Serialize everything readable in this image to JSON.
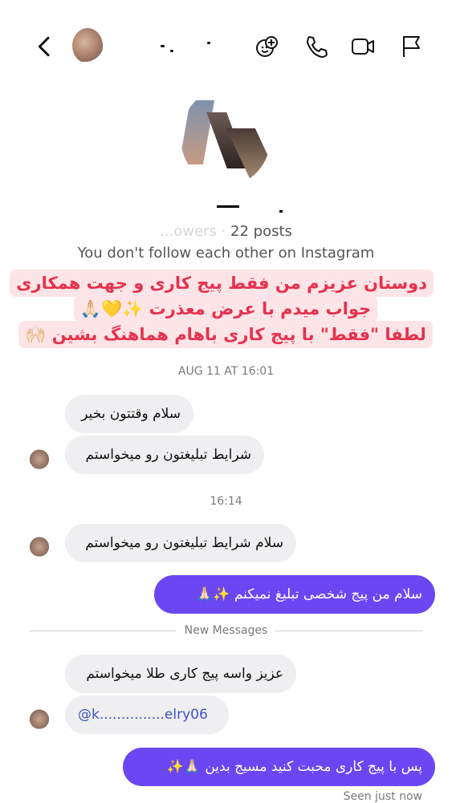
{
  "header": {
    "back_icon": "chevron-left-icon",
    "actions": [
      {
        "name": "effects-icon"
      },
      {
        "name": "phone-icon"
      },
      {
        "name": "video-icon"
      },
      {
        "name": "flag-icon"
      }
    ]
  },
  "profile": {
    "stats": "22 posts",
    "stats_prefix": "...owers · ",
    "follow_note": "You don't follow each other on Instagram"
  },
  "announcement": {
    "lines": [
      "دوستان عزیزم من فقط پیج کاری و جهت همکاری",
      "جواب میدم با عرض معذرت ✨💛🙏🏻",
      "لطفا \"فقط\" با پیج کاری باهام هماهنگ بشین 🙌🏻"
    ]
  },
  "conversation": {
    "timestamp_1": "AUG 11 AT 16:01",
    "timestamp_2": "16:14",
    "divider": "New Messages",
    "messages": [
      {
        "direction": "in",
        "text": "سلام وقتتون بخیر"
      },
      {
        "direction": "in",
        "text": "شرایط تبلیغتون رو میخواستم"
      },
      {
        "direction": "in",
        "text": "سلام شرایط تبلیغتون رو میخواستم"
      },
      {
        "direction": "out",
        "text": "سلام من پیج شخصی تبلیغ نمیکنم ✨🙏🏻"
      },
      {
        "direction": "in",
        "text": "عزیز واسه پیج کاری طلا میخواستم"
      },
      {
        "direction": "in",
        "text": "@k...............elry06"
      },
      {
        "direction": "out",
        "text": "پس با پیج کاری محبت کنید مسیج بدین 🙏🏻✨"
      }
    ],
    "seen": "Seen just now"
  },
  "colors": {
    "outgoing_bubble": "#6a47f3",
    "incoming_bubble": "#efeff1",
    "announcement_text": "#e5324e",
    "announcement_bg": "#fde4e7"
  }
}
